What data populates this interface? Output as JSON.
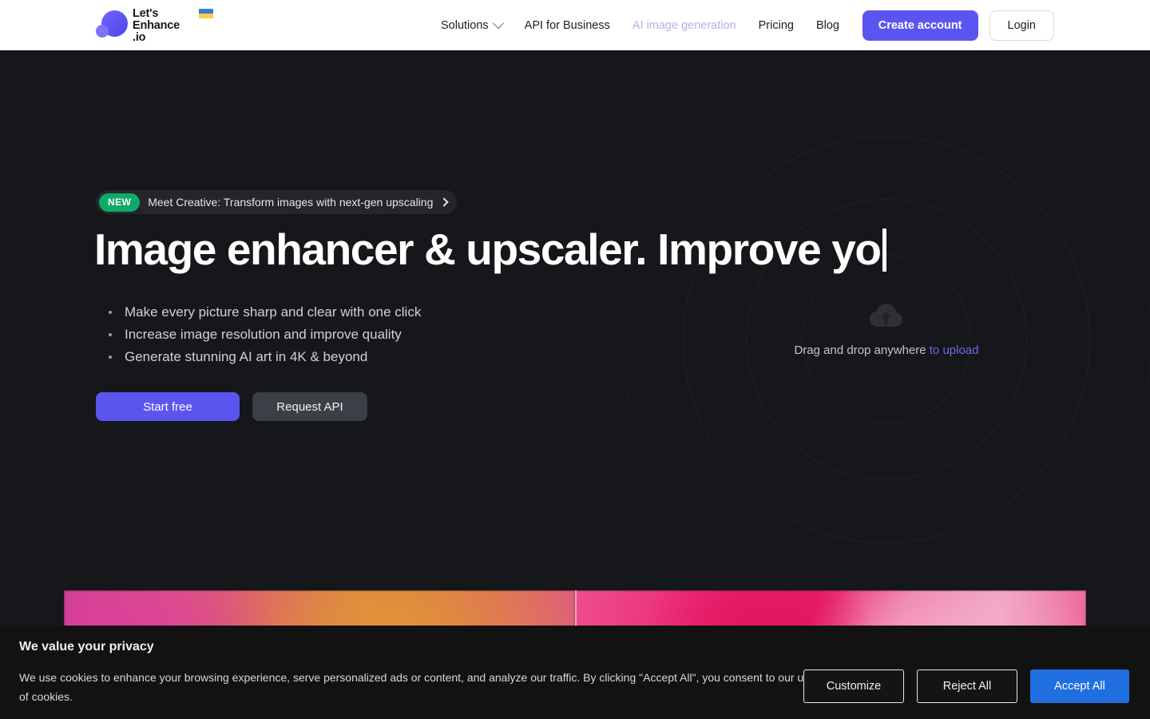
{
  "header": {
    "logo": {
      "line1": "Let's",
      "line2": "Enhance",
      "line3": ".io",
      "flag": "ukraine-flag"
    },
    "nav": [
      {
        "label": "Solutions",
        "muted": false,
        "has_chevron": true
      },
      {
        "label": "API for Business",
        "muted": false,
        "has_chevron": false
      },
      {
        "label": "AI image generation",
        "muted": true,
        "has_chevron": false
      },
      {
        "label": "Pricing",
        "muted": false,
        "has_chevron": false
      },
      {
        "label": "Blog",
        "muted": false,
        "has_chevron": false
      }
    ],
    "create_account_label": "Create account",
    "login_label": "Login"
  },
  "hero": {
    "announcement": {
      "badge": "NEW",
      "text": "Meet Creative: Transform images with next-gen upscaling",
      "arrow_icon": "chevron-right-icon"
    },
    "headline_part1": "Image enhancer & upscaler.",
    "headline_part2": "Improve yo",
    "bullets": [
      "Make every picture sharp and clear with one click",
      "Increase image resolution and improve quality",
      "Generate stunning AI art in 4K & beyond"
    ],
    "start_free_label": "Start free",
    "request_api_label": "Request API",
    "dropzone": {
      "icon": "cloud-upload-icon",
      "text": "Drag and drop anywhere",
      "link": "to upload"
    }
  },
  "cookie_banner": {
    "title": "We value your privacy",
    "body": "We use cookies to enhance your browsing experience, serve personalized ads or content, and analyze our traffic. By clicking \"Accept All\", you consent to our use of cookies.",
    "customize_label": "Customize",
    "reject_label": "Reject All",
    "accept_label": "Accept All"
  },
  "colors": {
    "brand_indigo": "#5b55f0",
    "badge_green": "#0fa968",
    "accept_blue": "#1f6fe0",
    "hero_bg": "#16171a",
    "muted_nav": "#b5b0e8"
  }
}
